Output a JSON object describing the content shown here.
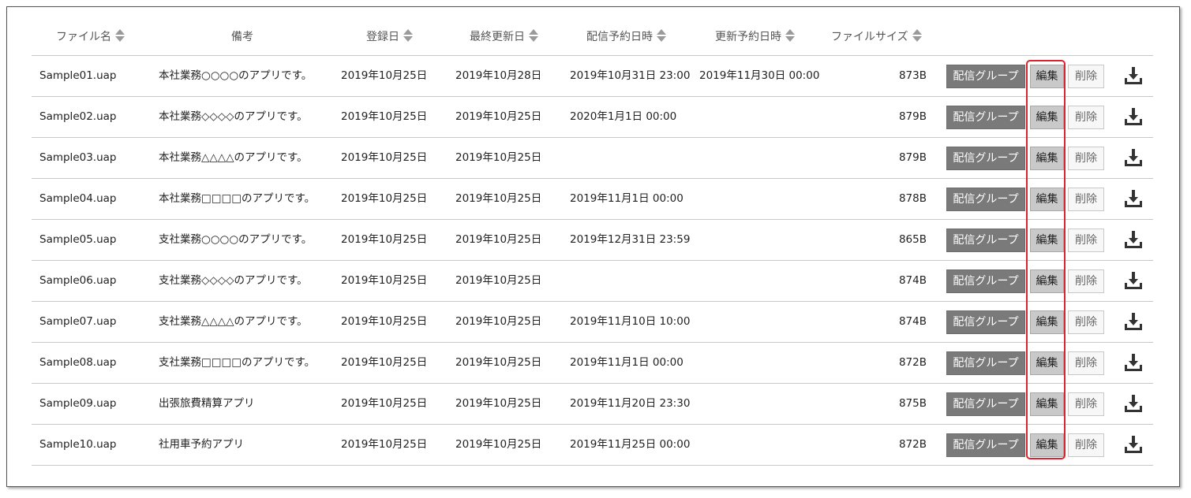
{
  "headers": {
    "file_name": "ファイル名",
    "note": "備考",
    "registered": "登録日",
    "last_updated": "最終更新日",
    "distribution_scheduled": "配信予約日時",
    "update_scheduled": "更新予約日時",
    "file_size": "ファイルサイズ"
  },
  "buttons": {
    "group": "配信グループ",
    "edit": "編集",
    "delete": "削除"
  },
  "rows": [
    {
      "file": "Sample01.uap",
      "note": "本社業務○○○○のアプリです。",
      "registered": "2019年10月25日",
      "updated": "2019年10月28日",
      "dist": "2019年10月31日 23:00",
      "sched": "2019年11月30日 00:00",
      "size": "873B"
    },
    {
      "file": "Sample02.uap",
      "note": "本社業務◇◇◇◇のアプリです。",
      "registered": "2019年10月25日",
      "updated": "2019年10月25日",
      "dist": "2020年1月1日 00:00",
      "sched": "",
      "size": "879B"
    },
    {
      "file": "Sample03.uap",
      "note": "本社業務△△△△のアプリです。",
      "registered": "2019年10月25日",
      "updated": "2019年10月25日",
      "dist": "",
      "sched": "",
      "size": "879B"
    },
    {
      "file": "Sample04.uap",
      "note": "本社業務□□□□のアプリです。",
      "registered": "2019年10月25日",
      "updated": "2019年10月25日",
      "dist": "2019年11月1日 00:00",
      "sched": "",
      "size": "878B"
    },
    {
      "file": "Sample05.uap",
      "note": "支社業務○○○○のアプリです。",
      "registered": "2019年10月25日",
      "updated": "2019年10月25日",
      "dist": "2019年12月31日 23:59",
      "sched": "",
      "size": "865B"
    },
    {
      "file": "Sample06.uap",
      "note": "支社業務◇◇◇◇のアプリです。",
      "registered": "2019年10月25日",
      "updated": "2019年10月25日",
      "dist": "",
      "sched": "",
      "size": "874B"
    },
    {
      "file": "Sample07.uap",
      "note": "支社業務△△△△のアプリです。",
      "registered": "2019年10月25日",
      "updated": "2019年10月25日",
      "dist": "2019年11月10日 10:00",
      "sched": "",
      "size": "874B"
    },
    {
      "file": "Sample08.uap",
      "note": "支社業務□□□□のアプリです。",
      "registered": "2019年10月25日",
      "updated": "2019年10月25日",
      "dist": "2019年11月1日 00:00",
      "sched": "",
      "size": "872B"
    },
    {
      "file": "Sample09.uap",
      "note": "出張旅費精算アプリ",
      "registered": "2019年10月25日",
      "updated": "2019年10月25日",
      "dist": "2019年11月20日 23:30",
      "sched": "",
      "size": "875B"
    },
    {
      "file": "Sample10.uap",
      "note": "社用車予約アプリ",
      "registered": "2019年10月25日",
      "updated": "2019年10月25日",
      "dist": "2019年11月25日 00:00",
      "sched": "",
      "size": "872B"
    }
  ],
  "colors": {
    "group_button": "#7a7a7a",
    "edit_button": "#c9c9c9",
    "highlight": "#d9232d"
  },
  "icons": {
    "sort": "sort-arrows-icon",
    "download": "download-icon"
  }
}
